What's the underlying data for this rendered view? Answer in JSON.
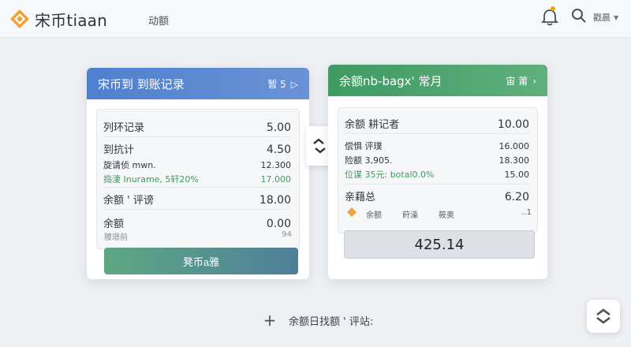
{
  "header": {
    "brand_name": "宋币tiaan",
    "nav_item": "动额",
    "user_label": "戳晨",
    "accent_color": "#f0a500"
  },
  "left_card": {
    "title": "宋币到 到账记录",
    "meta": "暂 5",
    "rows": [
      {
        "label": "列环记录",
        "value": "5.00"
      },
      {
        "label": "到抗计",
        "value": "4.50"
      },
      {
        "label": "旋请侦 mwn.",
        "value": "12.300"
      },
      {
        "label": "捣淒 Inurame, 5轩20%",
        "value": "17.000"
      },
      {
        "label": "余额 ' 评谤",
        "value": "18.00"
      },
      {
        "label": "余额",
        "value": "0.00"
      }
    ],
    "footer_label": "腰璟前",
    "footer_value": "94",
    "button_label": "凳币a雅",
    "header_color": "#4f7fcf"
  },
  "right_card": {
    "title": "余额nb-bagx' 常月",
    "meta": "宙 莆",
    "rows": [
      {
        "label": "余额 耕记者",
        "value": "10.00"
      },
      {
        "label": "偿惧 评璞",
        "value": "16.000"
      },
      {
        "label": "险额 3,905.",
        "value": "18.300"
      },
      {
        "label": "位谋 35元: botal0.0%",
        "value": "15.00"
      },
      {
        "label": "亲藉总",
        "value": "6.20"
      }
    ],
    "icon_labels": [
      "余额",
      "莳澡",
      "筱奥"
    ],
    "icon_row_value": "..1",
    "total": "425.14",
    "header_color": "#3e9a62"
  },
  "bottom": {
    "add_label": "余额日找额 ' 评站:"
  }
}
